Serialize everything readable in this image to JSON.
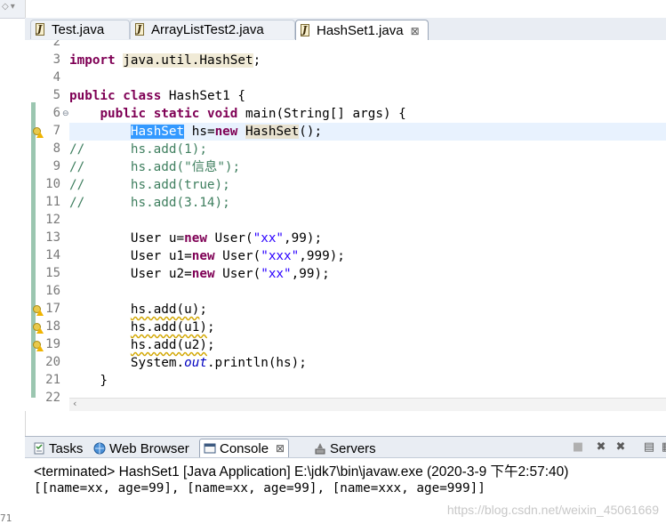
{
  "left_panel": {
    "line_fragment": "71"
  },
  "editor_tabs": [
    {
      "label": "Test.java",
      "active": false
    },
    {
      "label": "ArrayListTest2.java",
      "active": false
    },
    {
      "label": "HashSet1.java",
      "active": true,
      "close_glyph": "⊠"
    }
  ],
  "editor": {
    "gutter": {
      "line_numbers": [
        "2",
        "3",
        "4",
        "5",
        "6",
        "7",
        "8",
        "9",
        "10",
        "11",
        "12",
        "13",
        "14",
        "15",
        "16",
        "17",
        "18",
        "19",
        "20",
        "21",
        "22"
      ],
      "fold_marker_line": "6",
      "warning_lines": [
        "7",
        "17",
        "18",
        "19"
      ]
    },
    "code": {
      "l3": {
        "kw": "import",
        "pkg": "java.util.HashSet",
        "semi": ";"
      },
      "l5": {
        "kw1": "public",
        "kw2": "class",
        "rest": " HashSet1 {"
      },
      "l6": {
        "indent": "    ",
        "kw1": "public",
        "kw2": "static",
        "kw3": "void",
        "rest": " main(String[] args) {"
      },
      "l7": {
        "indent": "        ",
        "type_sel": "HashSet",
        "mid": " hs=",
        "kw": "new",
        "type2": "HashSet",
        "end": "();"
      },
      "l8": "//      hs.add(1);",
      "l9": "//      hs.add(\"信息\");",
      "l10": "//      hs.add(true);",
      "l11": "//      hs.add(3.14);",
      "l13": {
        "pre": "        User u=",
        "kw": "new",
        "mid": " User(",
        "str": "\"xx\"",
        "end": ",99);"
      },
      "l14": {
        "pre": "        User u1=",
        "kw": "new",
        "mid": " User(",
        "str": "\"xxx\"",
        "end": ",999);"
      },
      "l15": {
        "pre": "        User u2=",
        "kw": "new",
        "mid": " User(",
        "str": "\"xx\"",
        "end": ",99);"
      },
      "l17": {
        "indent": "        ",
        "text": "hs.add(u)",
        "end": ";"
      },
      "l18": {
        "indent": "        ",
        "text": "hs.add(u1)",
        "end": ";"
      },
      "l19": {
        "indent": "        ",
        "text": "hs.add(u2)",
        "end": ";"
      },
      "l20": {
        "pre": "        System.",
        "field": "out",
        "end": ".println(hs);"
      },
      "l21": "    }",
      "l23": "}"
    }
  },
  "console_tabs": [
    {
      "label": "Tasks",
      "icon": "tasks-icon"
    },
    {
      "label": "Web Browser",
      "icon": "globe-icon"
    },
    {
      "label": "Console",
      "icon": "console-icon",
      "active": true,
      "close_glyph": "⊠"
    },
    {
      "label": "Servers",
      "icon": "servers-icon"
    }
  ],
  "console": {
    "status": "<terminated> HashSet1 [Java Application] E:\\jdk7\\bin\\javaw.exe (2020-3-9 下午2:57:40)",
    "output": "[[name=xx, age=99], [name=xx, age=99], [name=xxx, age=999]]"
  },
  "watermark": "https://blog.csdn.net/weixin_45061669",
  "colors": {
    "keyword": "#7f0055",
    "comment": "#3f7f5f",
    "string": "#2a00ff",
    "field": "#0000c0",
    "selection": "#3399ff",
    "current_line": "#e8f2fe"
  }
}
